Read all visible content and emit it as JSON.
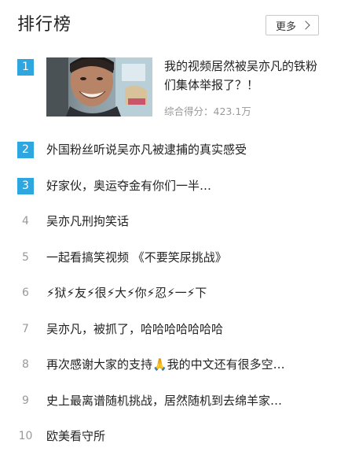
{
  "header": {
    "title": "排行榜",
    "more_label": "更多"
  },
  "featured": {
    "rank": "1",
    "title": "我的视频居然被吴亦凡的铁粉们集体举报了？！",
    "score": "综合得分：423.1万"
  },
  "items": [
    {
      "rank": "2",
      "title": "外国粉丝听说吴亦凡被逮捕的真实感受"
    },
    {
      "rank": "3",
      "title": "好家伙，奥运夺金有你们一半…"
    },
    {
      "rank": "4",
      "title": "吴亦凡刑拘笑话"
    },
    {
      "rank": "5",
      "title": "一起看搞笑视频 《不要笑尿挑战》"
    },
    {
      "rank": "6",
      "title": "⚡狱⚡友⚡很⚡大⚡你⚡忍⚡一⚡下"
    },
    {
      "rank": "7",
      "title": "吴亦凡，被抓了，哈哈哈哈哈哈哈"
    },
    {
      "rank": "8",
      "title": "再次感谢大家的支持🙏我的中文还有很多空…"
    },
    {
      "rank": "9",
      "title": "史上最离谱随机挑战，居然随机到去绵羊家…"
    },
    {
      "rank": "10",
      "title": "欧美看守所"
    }
  ],
  "colors": {
    "rank_badge": "#2ea7e0",
    "rank_plain": "#999999",
    "text": "#222222",
    "score": "#999999"
  }
}
